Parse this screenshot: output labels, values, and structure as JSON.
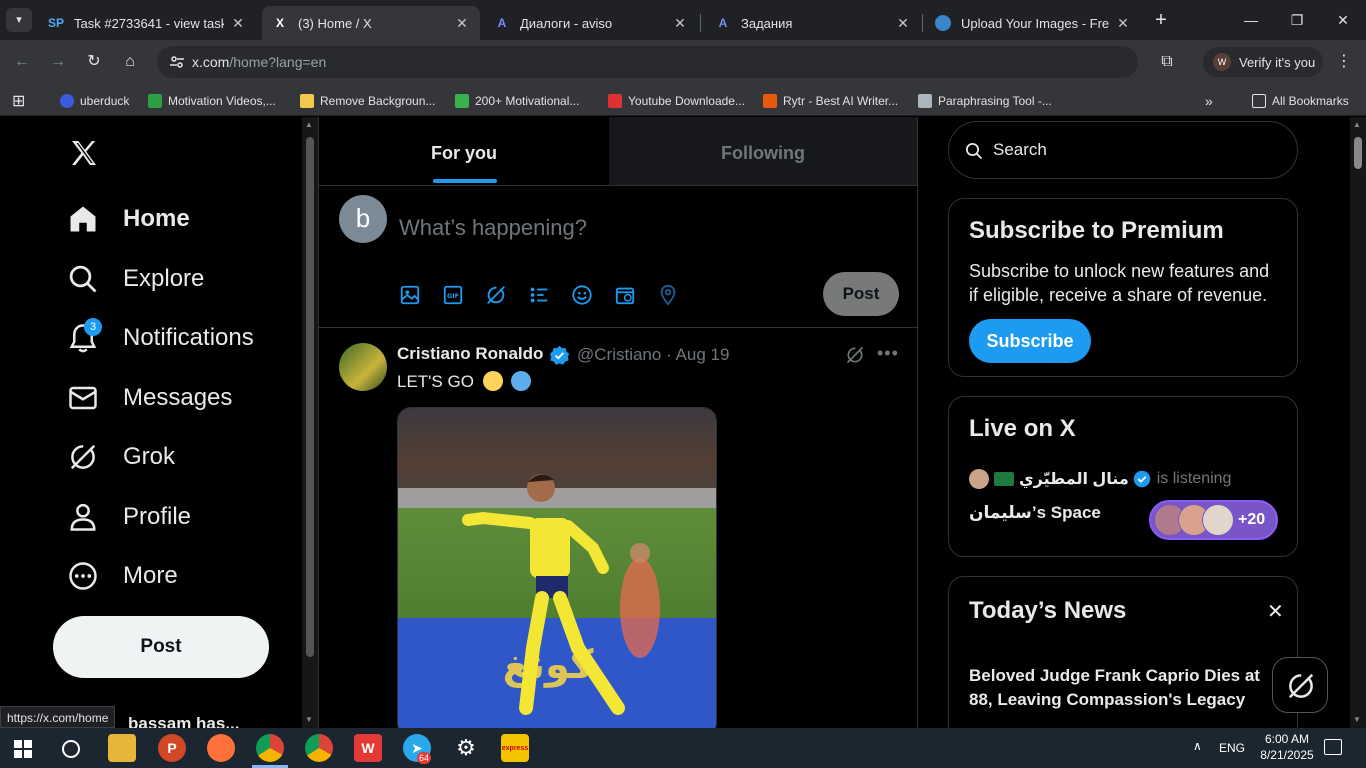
{
  "browser": {
    "tabs": [
      {
        "title": "Task #2733641 - view task",
        "favicon": "SP"
      },
      {
        "title": "(3) Home / X",
        "favicon": "X",
        "active": true
      },
      {
        "title": "Диалоги - aviso",
        "favicon": "A"
      },
      {
        "title": "Задания",
        "favicon": "A"
      },
      {
        "title": "Upload Your Images - Free In",
        "favicon": "globe"
      }
    ],
    "url_host": "x.com",
    "url_path": "/home?lang=en",
    "verify_label": "Verify it's you",
    "verify_avatar": "W",
    "bookmarks": [
      {
        "label": "uberduck",
        "color": "#3b5bdb"
      },
      {
        "label": "Motivation Videos,...",
        "color": "#2f9e44"
      },
      {
        "label": "Remove Backgroun...",
        "color": "#f2c94c"
      },
      {
        "label": "200+ Motivational...",
        "color": "#37b24d"
      },
      {
        "label": "Youtube Downloade...",
        "color": "#e03131"
      },
      {
        "label": "Rytr - Best AI Writer...",
        "color": "#e8590c"
      },
      {
        "label": "Paraphrasing Tool -...",
        "color": "#adb5bd"
      }
    ],
    "all_bookmarks": "All Bookmarks",
    "status_url": "https://x.com/home"
  },
  "nav": {
    "items": [
      {
        "label": "Home",
        "icon": "home-icon"
      },
      {
        "label": "Explore",
        "icon": "search-icon"
      },
      {
        "label": "Notifications",
        "icon": "bell-icon"
      },
      {
        "label": "Messages",
        "icon": "mail-icon"
      },
      {
        "label": "Grok",
        "icon": "grok-icon"
      },
      {
        "label": "Profile",
        "icon": "person-icon"
      },
      {
        "label": "More",
        "icon": "more-circle-icon"
      }
    ],
    "notifications_count": "3",
    "post_label": "Post",
    "account_name": "bassam has..."
  },
  "feed": {
    "tab_for_you": "For you",
    "tab_following": "Following",
    "compose_avatar": "b",
    "compose_placeholder": "What’s happening?",
    "compose_post": "Post",
    "tweet": {
      "name": "Cristiano Ronaldo",
      "handle": "@Cristiano",
      "date": "Aug 19",
      "text": "LET'S GO"
    }
  },
  "right": {
    "search_placeholder": "Search",
    "premium_title": "Subscribe to Premium",
    "premium_desc": "Subscribe to unlock new features and if eligible, receive a share of revenue.",
    "subscribe_label": "Subscribe",
    "live_title": "Live on X",
    "live_host": "منال المطيّري",
    "live_status": "is listening",
    "live_space": "سليمان’s Space",
    "live_count": "+20",
    "news_title": "Today’s News",
    "news_headline": "Beloved Judge Frank Caprio Dies at 88, Leaving Compassion's Legacy"
  },
  "taskbar": {
    "lang": "ENG",
    "time": "6:00 AM",
    "date": "8/21/2025",
    "telegram_badge": "64",
    "express_label": "express"
  }
}
